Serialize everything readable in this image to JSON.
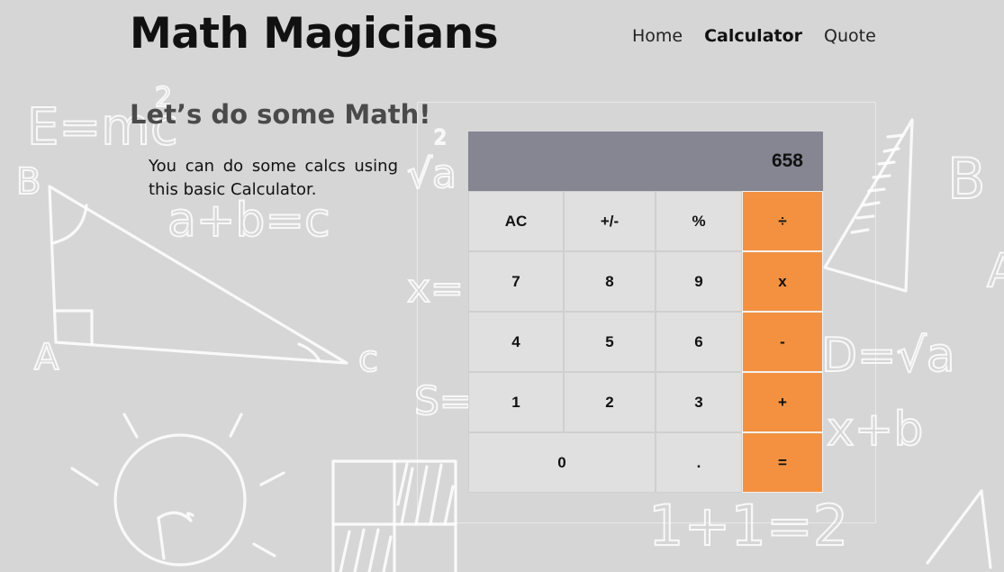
{
  "header": {
    "logo": "Math Magicians",
    "nav": [
      {
        "label": "Home",
        "active": false
      },
      {
        "label": "Calculator",
        "active": true
      },
      {
        "label": "Quote",
        "active": false
      }
    ]
  },
  "intro": {
    "heading": "Let’s do some Math!",
    "description": "You can do some calcs using this basic Calculator."
  },
  "calculator": {
    "display": "658",
    "keys": [
      {
        "label": "AC",
        "type": "function",
        "name": "ac-button"
      },
      {
        "label": "+/-",
        "type": "function",
        "name": "sign-toggle-button"
      },
      {
        "label": "%",
        "type": "function",
        "name": "percent-button"
      },
      {
        "label": "÷",
        "type": "operator",
        "name": "divide-button"
      },
      {
        "label": "7",
        "type": "digit",
        "name": "digit-7-button"
      },
      {
        "label": "8",
        "type": "digit",
        "name": "digit-8-button"
      },
      {
        "label": "9",
        "type": "digit",
        "name": "digit-9-button"
      },
      {
        "label": "x",
        "type": "operator",
        "name": "multiply-button"
      },
      {
        "label": "4",
        "type": "digit",
        "name": "digit-4-button"
      },
      {
        "label": "5",
        "type": "digit",
        "name": "digit-5-button"
      },
      {
        "label": "6",
        "type": "digit",
        "name": "digit-6-button"
      },
      {
        "label": "-",
        "type": "operator",
        "name": "subtract-button"
      },
      {
        "label": "1",
        "type": "digit",
        "name": "digit-1-button"
      },
      {
        "label": "2",
        "type": "digit",
        "name": "digit-2-button"
      },
      {
        "label": "3",
        "type": "digit",
        "name": "digit-3-button"
      },
      {
        "label": "+",
        "type": "operator",
        "name": "add-button"
      },
      {
        "label": "0",
        "type": "digit-wide",
        "name": "digit-0-button"
      },
      {
        "label": ".",
        "type": "digit",
        "name": "decimal-button"
      },
      {
        "label": "=",
        "type": "operator",
        "name": "equals-button"
      }
    ]
  },
  "colors": {
    "background": "#d6d6d6",
    "display": "#858692",
    "key": "#e0e0e0",
    "operator": "#f39140"
  }
}
